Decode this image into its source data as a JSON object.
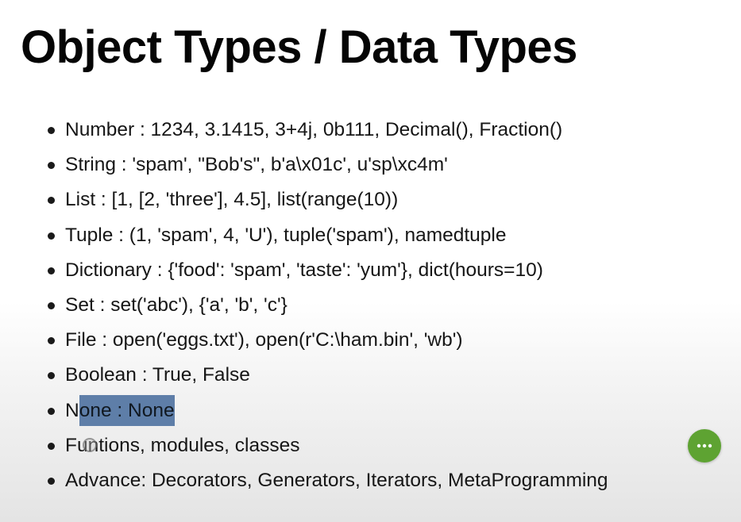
{
  "slide": {
    "title": "Object Types / Data Types",
    "bullets": [
      "Number : 1234, 3.1415, 3+4j, 0b111, Decimal(), Fraction()",
      "String : 'spam', \"Bob's\", b'a\\x01c', u'sp\\xc4m'",
      "List : [1, [2, 'three'], 4.5], list(range(10))",
      "Tuple : (1, 'spam', 4, 'U'), tuple('spam'), namedtuple",
      "Dictionary : {'food': 'spam', 'taste': 'yum'}, dict(hours=10)",
      "Set : set('abc'), {'a', 'b', 'c'}",
      "File : open('eggs.txt'), open(r'C:\\ham.bin', 'wb')",
      "Boolean : True, False"
    ],
    "none_item": {
      "prefix": "N",
      "selected": "one : None"
    },
    "bullets_after": [
      "Funtions, modules, classes",
      "Advance: Decorators, Generators, Iterators, MetaProgramming"
    ]
  },
  "controls": {
    "more_button_icon": "more-horizontal-icon",
    "more_button_color": "#5ea332",
    "selection_color": "#5e7ea8"
  }
}
